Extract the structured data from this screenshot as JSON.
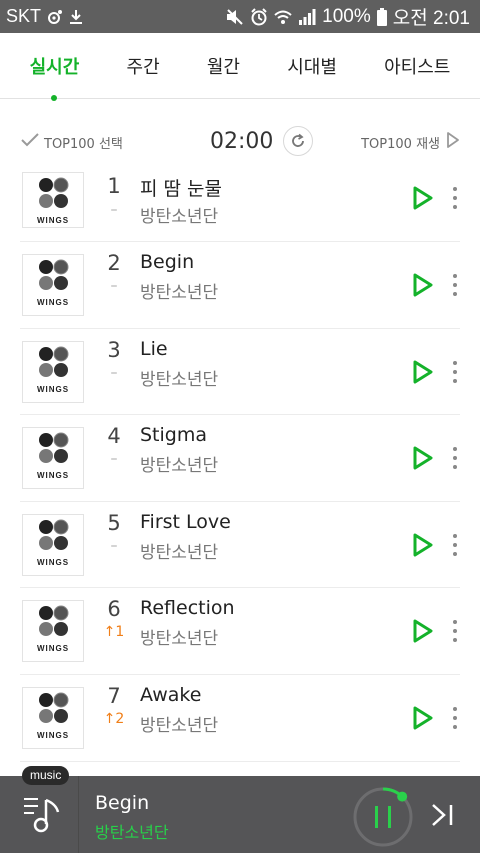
{
  "status_bar": {
    "carrier": "SKT",
    "battery": "100%",
    "time": "오전 2:01",
    "icons": [
      "settings-icon",
      "download-icon",
      "mute-icon",
      "alarm-icon",
      "wifi-icon",
      "signal-icon",
      "battery-icon"
    ]
  },
  "tabs": [
    {
      "label": "실시간",
      "active": true
    },
    {
      "label": "주간",
      "active": false
    },
    {
      "label": "월간",
      "active": false
    },
    {
      "label": "시대별",
      "active": false
    },
    {
      "label": "아티스트",
      "active": false
    }
  ],
  "controls": {
    "select_label": "TOP100 선택",
    "time": "02:00",
    "play_label": "TOP100 재생"
  },
  "album_label": "WINGS",
  "songs": [
    {
      "rank": "1",
      "change": "–",
      "title": "피 땀 눈물",
      "artist": "방탄소년단"
    },
    {
      "rank": "2",
      "change": "–",
      "title": "Begin",
      "artist": "방탄소년단"
    },
    {
      "rank": "3",
      "change": "–",
      "title": "Lie",
      "artist": "방탄소년단"
    },
    {
      "rank": "4",
      "change": "–",
      "title": "Stigma",
      "artist": "방탄소년단"
    },
    {
      "rank": "5",
      "change": "–",
      "title": "First Love",
      "artist": "방탄소년단"
    },
    {
      "rank": "6",
      "change": "↑1",
      "title": "Reflection",
      "artist": "방탄소년단"
    },
    {
      "rank": "7",
      "change": "↑2",
      "title": "Awake",
      "artist": "방탄소년단"
    }
  ],
  "player": {
    "badge": "music",
    "title": "Begin",
    "artist": "방탄소년단",
    "progress": 0.12
  },
  "colors": {
    "accent": "#14b22a",
    "rank_up": "#f07f19",
    "status_bar": "#5f5f5f",
    "player_bg": "#555557"
  }
}
